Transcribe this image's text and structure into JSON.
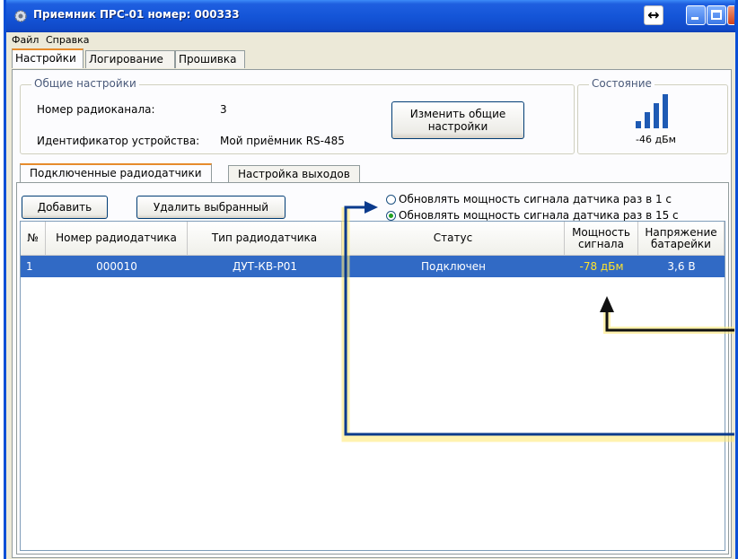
{
  "window": {
    "title": "Приемник ПРС-01 номер: 000333",
    "resize_glyph": "↔",
    "icons": [
      "gear-icon",
      "resize-icon",
      "minimize-icon",
      "maximize-icon",
      "close-icon"
    ]
  },
  "menu": {
    "items": [
      "Файл",
      "Справка"
    ]
  },
  "tabs": [
    "Настройки",
    "Логирование",
    "Прошивка"
  ],
  "general": {
    "title": "Общие настройки",
    "channel_label": "Номер радиоканала:",
    "channel_value": "3",
    "device_label": "Идентификатор устройства:",
    "device_value": "Мой приёмник RS-485",
    "change_button_line1": "Изменить общие",
    "change_button_line2": "настройки"
  },
  "state": {
    "title": "Состояние",
    "signal_text": "-46 дБм",
    "bars_lit": 4
  },
  "subtabs": [
    "Подключенные радиодатчики",
    "Настройка выходов"
  ],
  "actions": {
    "add": "Добавить",
    "delete": "Удалить выбранный"
  },
  "update_options": {
    "option1": "Обновлять мощность сигнала датчика раз в 1 с",
    "option2": "Обновлять мощность сигнала датчика раз в 15 с",
    "selected": 2
  },
  "table": {
    "headers": {
      "num": "№",
      "sensor_no": "Номер радиодатчика",
      "sensor_type": "Тип радиодатчика",
      "status": "Статус",
      "power_l1": "Мощность",
      "power_l2": "сигнала",
      "voltage_l1": "Напряжение",
      "voltage_l2": "батарейки"
    },
    "rows": [
      {
        "num": "1",
        "sensor_no": "000010",
        "sensor_type": "ДУТ-КВ-Р01",
        "status": "Подключен",
        "power": "-78 дБм",
        "voltage": "3,6 В"
      }
    ]
  },
  "colors": {
    "titlebar": "#1455d8",
    "selection": "#316ac5",
    "power_highlight": "#ffe32b",
    "annotation": "#0a3a8c"
  }
}
